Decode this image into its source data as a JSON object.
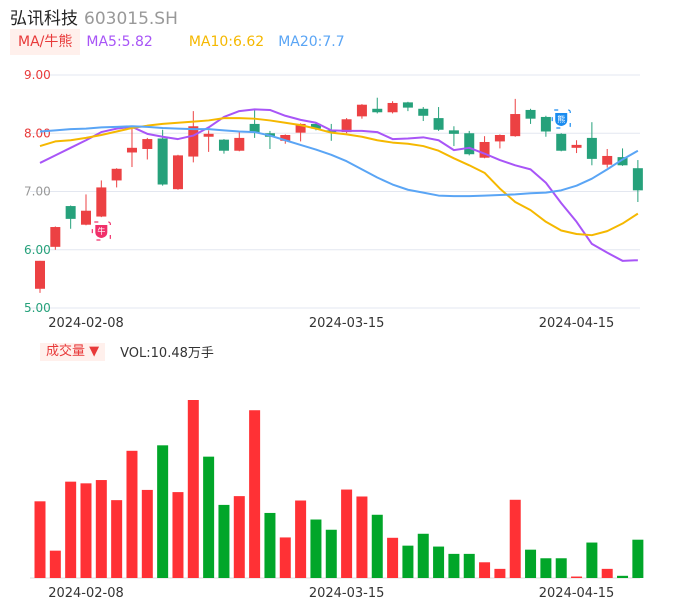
{
  "header": {
    "name": "弘讯科技",
    "code": "603015.SH"
  },
  "legend": {
    "badge": "MA/牛熊",
    "ma5": "MA5:5.82",
    "ma10": "MA10:6.62",
    "ma20": "MA20:7.7"
  },
  "volume_header": {
    "badge": "成交量 ▼",
    "value": "VOL:10.48万手"
  },
  "markers": {
    "bull": "牛",
    "bear": "熊"
  },
  "colors": {
    "up": "#ec4143",
    "down": "#26a17b",
    "vol_up": "#ff3135",
    "vol_down": "#01a629",
    "ma5": "#a855f7",
    "ma10": "#f5b800",
    "ma20": "#5aa5f5",
    "grid": "#e3e7f0"
  },
  "chart_data": {
    "type": "candlestick",
    "ylim": [
      5,
      9
    ],
    "yticks": [
      "9.00",
      "8.00",
      "7.00",
      "6.00",
      "5.00"
    ],
    "xticks": [
      {
        "index": 3,
        "label": "2024-02-08"
      },
      {
        "index": 20,
        "label": "2024-03-15"
      },
      {
        "index": 35,
        "label": "2024-04-15"
      }
    ],
    "bull_marker_index": 4,
    "bear_marker_index": 34,
    "ohlc": [
      [
        5.33,
        5.81,
        5.81,
        5.26
      ],
      [
        6.05,
        6.39,
        6.4,
        6.0
      ],
      [
        6.75,
        6.53,
        6.76,
        6.36
      ],
      [
        6.43,
        6.67,
        6.95,
        6.42
      ],
      [
        6.57,
        7.07,
        7.19,
        6.56
      ],
      [
        7.19,
        7.39,
        7.4,
        7.07
      ],
      [
        7.67,
        7.75,
        8.08,
        7.42
      ],
      [
        7.73,
        7.9,
        7.92,
        7.55
      ],
      [
        7.91,
        7.12,
        8.06,
        7.1
      ],
      [
        7.04,
        7.62,
        7.63,
        7.03
      ],
      [
        7.6,
        8.12,
        8.38,
        7.5
      ],
      [
        7.94,
        7.99,
        8.05,
        7.68
      ],
      [
        7.89,
        7.7,
        7.9,
        7.65
      ],
      [
        7.7,
        7.92,
        8.03,
        7.69
      ],
      [
        8.16,
        8.01,
        8.4,
        7.92
      ],
      [
        8.0,
        7.94,
        8.04,
        7.73
      ],
      [
        7.87,
        7.97,
        7.98,
        7.82
      ],
      [
        8.01,
        8.16,
        8.17,
        7.86
      ],
      [
        8.16,
        8.08,
        8.19,
        8.05
      ],
      [
        8.05,
        8.02,
        8.16,
        7.87
      ],
      [
        8.02,
        8.24,
        8.26,
        8.0
      ],
      [
        8.29,
        8.49,
        8.5,
        8.25
      ],
      [
        8.42,
        8.36,
        8.61,
        8.34
      ],
      [
        8.36,
        8.52,
        8.55,
        8.34
      ],
      [
        8.53,
        8.44,
        8.54,
        8.38
      ],
      [
        8.42,
        8.3,
        8.45,
        8.21
      ],
      [
        8.26,
        8.06,
        8.45,
        8.04
      ],
      [
        8.05,
        7.99,
        8.12,
        7.78
      ],
      [
        8.0,
        7.64,
        8.04,
        7.62
      ],
      [
        7.58,
        7.85,
        7.95,
        7.57
      ],
      [
        7.86,
        7.97,
        7.98,
        7.74
      ],
      [
        7.95,
        8.33,
        8.59,
        7.94
      ],
      [
        8.4,
        8.25,
        8.42,
        8.16
      ],
      [
        8.28,
        8.03,
        8.3,
        7.94
      ],
      [
        7.99,
        7.7,
        8.0,
        7.69
      ],
      [
        7.75,
        7.8,
        7.88,
        7.66
      ],
      [
        7.92,
        7.56,
        8.19,
        7.45
      ],
      [
        7.46,
        7.61,
        7.73,
        7.41
      ],
      [
        7.59,
        7.45,
        7.74,
        7.44
      ],
      [
        7.4,
        7.02,
        7.54,
        6.82
      ]
    ],
    "ma5": [
      7.49,
      7.62,
      7.75,
      7.88,
      8.02,
      8.08,
      8.11,
      7.99,
      7.94,
      7.9,
      7.96,
      8.1,
      8.28,
      8.38,
      8.41,
      8.4,
      8.3,
      8.23,
      8.18,
      8.05,
      8.04,
      8.04,
      8.02,
      7.9,
      7.91,
      7.93,
      7.88,
      7.71,
      7.75,
      7.65,
      7.54,
      7.45,
      7.38,
      7.15,
      6.8,
      6.48,
      6.1,
      5.95,
      5.81,
      5.82
    ],
    "ma10": [
      7.78,
      7.86,
      7.88,
      7.92,
      7.97,
      8.03,
      8.09,
      8.13,
      8.16,
      8.18,
      8.2,
      8.22,
      8.26,
      8.26,
      8.25,
      8.22,
      8.18,
      8.14,
      8.08,
      8.01,
      7.98,
      7.94,
      7.88,
      7.84,
      7.82,
      7.78,
      7.7,
      7.57,
      7.45,
      7.32,
      7.05,
      6.82,
      6.68,
      6.48,
      6.33,
      6.27,
      6.25,
      6.32,
      6.45,
      6.62
    ],
    "ma20": [
      8.03,
      8.05,
      8.07,
      8.08,
      8.1,
      8.11,
      8.12,
      8.11,
      8.09,
      8.08,
      8.07,
      8.07,
      8.05,
      8.03,
      8.02,
      7.96,
      7.88,
      7.8,
      7.72,
      7.63,
      7.52,
      7.38,
      7.24,
      7.12,
      7.03,
      6.98,
      6.93,
      6.92,
      6.92,
      6.93,
      6.94,
      6.95,
      6.97,
      6.98,
      7.02,
      7.1,
      7.22,
      7.38,
      7.55,
      7.7
    ],
    "volume_unit": "万手",
    "volume": [
      20.98,
      7.48,
      26.36,
      25.9,
      26.8,
      21.3,
      34.8,
      24.1,
      36.3,
      23.5,
      48.7,
      33.2,
      20.0,
      22.4,
      45.9,
      17.8,
      11.1,
      21.2,
      16.0,
      13.2,
      24.2,
      22.3,
      17.3,
      11.0,
      8.85,
      12.1,
      8.6,
      6.6,
      6.6,
      4.3,
      2.5,
      21.4,
      7.75,
      5.4,
      5.4,
      0.4,
      9.7,
      2.5,
      0.6,
      10.48
    ],
    "volume_up": [
      1,
      1,
      1,
      1,
      1,
      1,
      1,
      1,
      0,
      1,
      1,
      0,
      0,
      1,
      1,
      0,
      1,
      1,
      0,
      0,
      1,
      1,
      0,
      1,
      0,
      0,
      0,
      0,
      0,
      1,
      1,
      1,
      0,
      0,
      0,
      1,
      0,
      1,
      0,
      0
    ]
  }
}
